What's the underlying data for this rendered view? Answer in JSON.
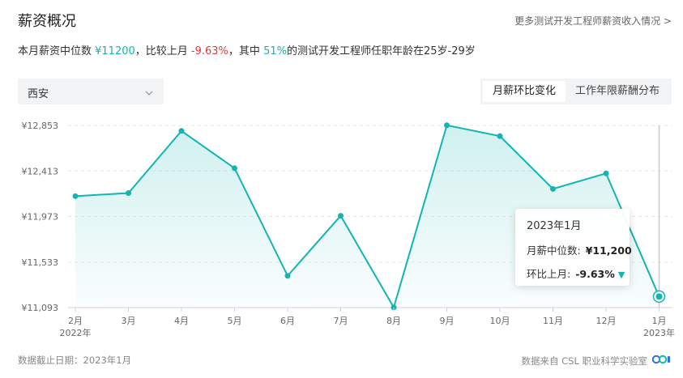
{
  "header": {
    "title": "薪资概况",
    "more_link": "更多测试开发工程师薪资收入情况 >"
  },
  "summary": {
    "prefix": "本月薪资中位数 ",
    "median": "¥11200",
    "mid1": "，比较上月 ",
    "change": "-9.63%",
    "mid2": "，其中 ",
    "percent": "51%",
    "suffix": "的测试开发工程师任职年龄在25岁-29岁"
  },
  "city_select": {
    "value": "西安"
  },
  "tabs": [
    {
      "label": "月薪环比变化",
      "active": true
    },
    {
      "label": "工作年限薪酬分布",
      "active": false
    }
  ],
  "tooltip": {
    "title": "2023年1月",
    "median_label": "月薪中位数:",
    "median_value": "¥11,200",
    "change_label": "环比上月:",
    "change_value": "-9.63%",
    "arrow": "▼"
  },
  "footer": {
    "date_note": "数据截止日期：2023年1月",
    "source": "数据来自 CSL 职业科学实验室"
  },
  "colors": {
    "accent": "#13b5b1",
    "negative": "#e4393c"
  },
  "chart_data": {
    "type": "area",
    "categories": [
      "2月",
      "3月",
      "4月",
      "5月",
      "6月",
      "7月",
      "8月",
      "9月",
      "10月",
      "11月",
      "12月",
      "1月"
    ],
    "category_years": [
      "2022年",
      "",
      "",
      "",
      "",
      "",
      "",
      "",
      "",
      "",
      "",
      "2023年"
    ],
    "series": [
      {
        "values": [
          12170,
          12200,
          12800,
          12440,
          11400,
          11980,
          11095,
          12855,
          12750,
          12240,
          12390,
          11200
        ]
      }
    ],
    "y_ticks": [
      11093,
      11533,
      11973,
      12413,
      12853
    ],
    "y_tick_labels": [
      "¥11,093",
      "¥11,533",
      "¥11,973",
      "¥12,413",
      "¥12,853"
    ],
    "ylim": [
      11093,
      12853
    ],
    "grid": true,
    "highlight_index": 11
  }
}
